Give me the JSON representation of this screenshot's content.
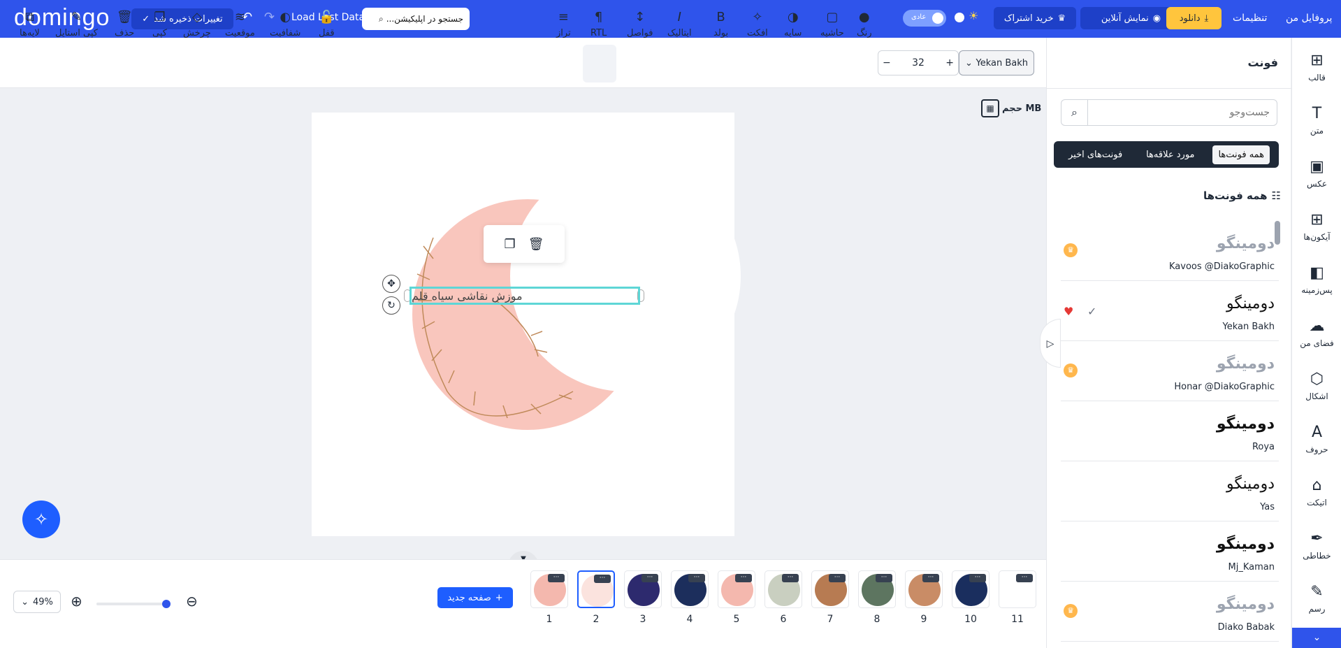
{
  "app": {
    "logo": "domingo"
  },
  "topbar": {
    "saved": "تغییرات ذخیره شد",
    "load_last": "Load Last Data",
    "search_placeholder": "جستجو در اپلیکیشن...",
    "toggle_label": "عادی",
    "buy": "خرید اشتراک",
    "online": "نمایش آنلاین",
    "download": "دانلود",
    "settings": "تنظیمات",
    "profile": "پروفایل من"
  },
  "toolbar": {
    "layers": "لایه‌ها",
    "copy_style": "کپی استایل",
    "delete": "حذف",
    "copy": "کپی",
    "rotate": "چرخش",
    "position": "موقعیت",
    "opacity": "شفافیت",
    "lock": "قفل",
    "align": "تراز",
    "rtl": "RTL",
    "spacing": "فواصل",
    "italic": "ایتالیک",
    "bold": "بولد",
    "effect": "افکت",
    "shadow": "سایه",
    "border": "حاشیه",
    "color": "رنگ",
    "font_size": "32",
    "font_name": "Yekan Bakh"
  },
  "canvas": {
    "size_label": "حجم MB",
    "text": "موزش نقاشی سیاه قلم",
    "colors": {
      "moon": "#f9c6bd",
      "selection": "#5ed6d6"
    }
  },
  "bottom": {
    "zoom": "49%",
    "new_page": "صفحه جدید",
    "pages": [
      "1",
      "2",
      "3",
      "4",
      "5",
      "6",
      "7",
      "8",
      "9",
      "10",
      "11"
    ],
    "selected_page": "2",
    "page_colors": [
      "#f4b8ae",
      "#fbe3de",
      "#2d2a6e",
      "#1c2e5c",
      "#f4b8ae",
      "#c9cfc0",
      "#b77b52",
      "#5d7560",
      "#c98c66",
      "#1a2e5e",
      "#ffffff"
    ]
  },
  "panel": {
    "title": "فونت",
    "search_placeholder": "جست‌وجو",
    "tabs": [
      "همه فونت‌ها",
      "مورد علاقه‌ها",
      "فونت‌های اخیر"
    ],
    "list_title": "همه فونت‌ها",
    "fonts": [
      {
        "sample": "دومینگو",
        "name": "Kavoos @DiakoGraphic"
      },
      {
        "sample": "دومینگو",
        "name": "Yekan Bakh"
      },
      {
        "sample": "دومینگو",
        "name": "Honar @DiakoGraphic"
      },
      {
        "sample": "دومینگو",
        "name": "Roya"
      },
      {
        "sample": "دومینگو",
        "name": "Yas"
      },
      {
        "sample": "دومینگو",
        "name": "Mj_Kaman"
      },
      {
        "sample": "دومینگو",
        "name": "Diako Babak"
      }
    ]
  },
  "sidebar": {
    "items": [
      "قالب",
      "متن",
      "عکس",
      "آیکون‌ها",
      "پس‌زمینه",
      "فضای من",
      "اشکال",
      "حروف",
      "اتیکت",
      "خطاطی",
      "رسم"
    ]
  }
}
